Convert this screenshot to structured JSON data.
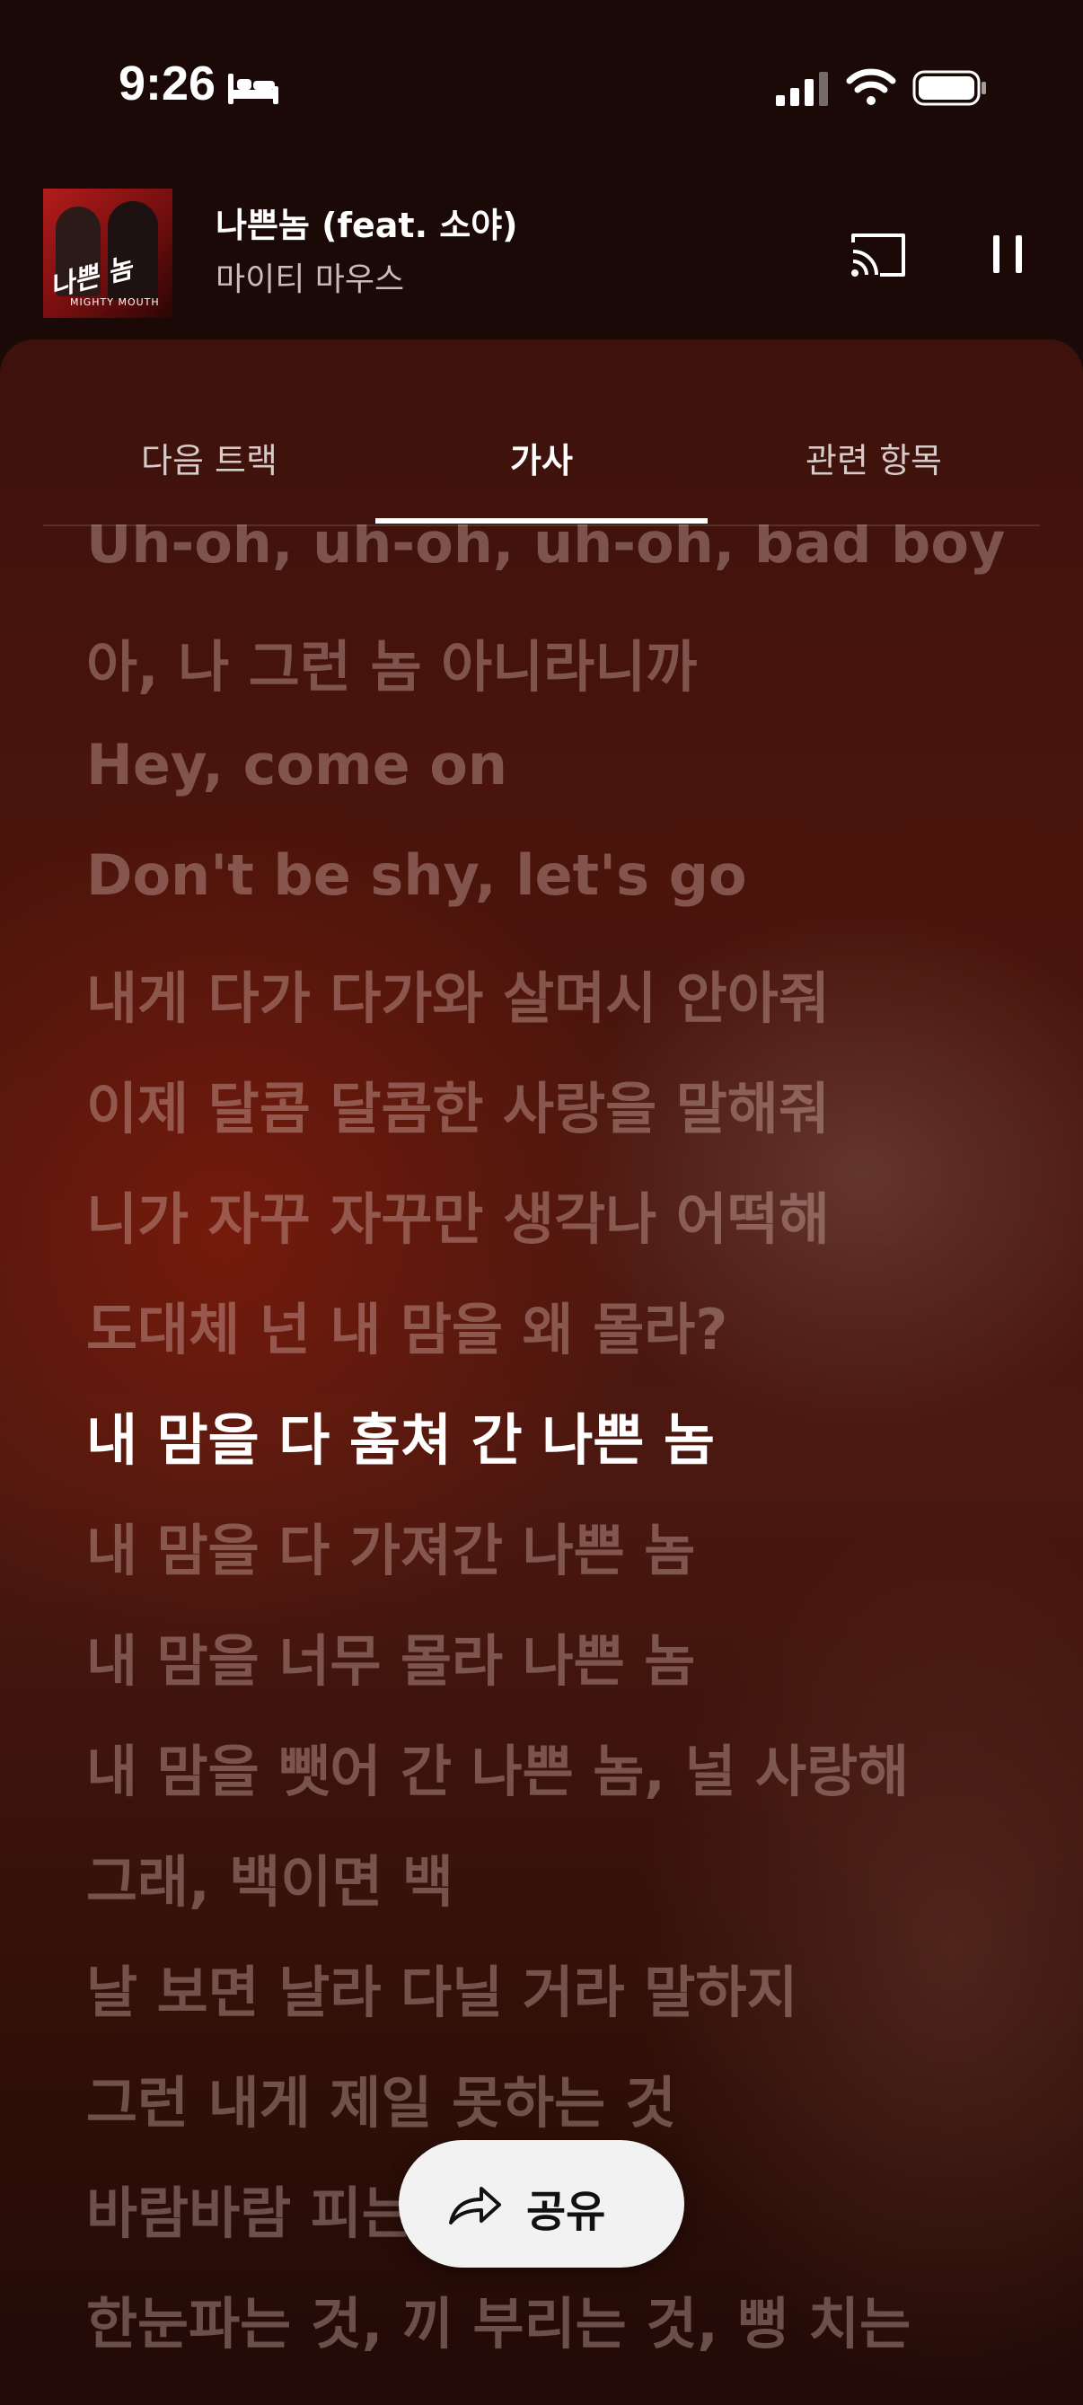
{
  "status_bar": {
    "time": "9:26",
    "icons": [
      "bed-icon",
      "signal-icon",
      "wifi-icon",
      "battery-icon"
    ]
  },
  "now_playing": {
    "title": "나쁜놈 (feat. 소야)",
    "artist": "마이티 마우스",
    "album_art_text": "나쁜 놈",
    "album_art_subtext": "MIGHTY MOUTH",
    "playback_state": "playing"
  },
  "tabs": [
    {
      "label": "다음 트랙",
      "active": false
    },
    {
      "label": "가사",
      "active": true
    },
    {
      "label": "관련 항목",
      "active": false
    }
  ],
  "lyrics": {
    "current_index": 8,
    "lines": [
      "Uh-oh, uh-oh, uh-oh, bad boy",
      "아, 나 그런 놈 아니라니까",
      "Hey, come on",
      "Don't be shy, let's go",
      "내게 다가 다가와 살며시 안아줘",
      "이제 달콤 달콤한 사랑을 말해줘",
      "니가 자꾸 자꾸만 생각나 어떡해",
      "도대체 넌 내 맘을 왜 몰라?",
      "내 맘을 다 훔쳐 간 나쁜 놈",
      "내 맘을 다 가져간 나쁜 놈",
      "내 맘을 너무 몰라 나쁜 놈",
      "내 맘을 뺏어 간 나쁜 놈, 널 사랑해",
      "그래, 백이면 백",
      "날 보면 날라 다닐 거라 말하지",
      "그런 내게 제일 못하는 것",
      "바람바람 피는 것",
      "한눈파는 것, 끼 부리는 것, 뻥 치는"
    ]
  },
  "share_button": {
    "label": "공유"
  },
  "colors": {
    "accent": "#ffffff",
    "background": "#1a0907",
    "inactive_lyric": "#e6c8c3"
  }
}
